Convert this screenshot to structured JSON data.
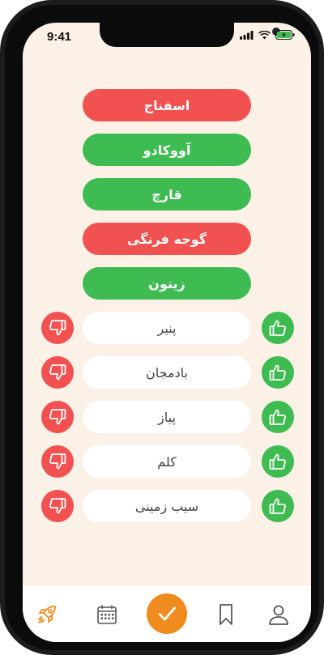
{
  "status": {
    "time": "9:41"
  },
  "decided": [
    {
      "label": "اسفناج",
      "state": "disliked"
    },
    {
      "label": "آووکادو",
      "state": "liked"
    },
    {
      "label": "قارچ",
      "state": "liked"
    },
    {
      "label": "گوجه فرنگی",
      "state": "disliked"
    },
    {
      "label": "زیتون",
      "state": "liked"
    }
  ],
  "pending": [
    {
      "label": "پنیر"
    },
    {
      "label": "بادمجان"
    },
    {
      "label": "پیاز"
    },
    {
      "label": "کلم"
    },
    {
      "label": "سیب زمینی"
    }
  ],
  "tabbar": {
    "tabs": [
      {
        "icon": "rocket-icon",
        "active": true
      },
      {
        "icon": "calendar-icon",
        "active": false
      },
      {
        "icon": "check-icon",
        "active": false
      },
      {
        "icon": "bookmark-icon",
        "active": false
      },
      {
        "icon": "profile-icon",
        "active": false
      }
    ]
  },
  "colors": {
    "like": "#3ebb51",
    "dislike": "#f25151",
    "accent": "#f08b1e",
    "background": "#fbf1e7"
  }
}
